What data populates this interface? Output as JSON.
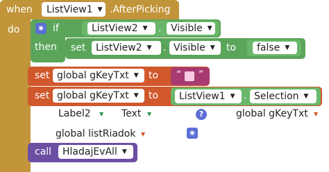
{
  "event": {
    "when": "when",
    "component": "ListView1",
    "event_name": ".AfterPicking",
    "do": "do"
  },
  "if_block": {
    "if": "if",
    "then": "then"
  },
  "cond": {
    "component": "ListView2",
    "dot": ".",
    "property": "Visible"
  },
  "set_visible": {
    "set": "set",
    "component": "ListView2",
    "dot": ".",
    "property": "Visible",
    "to": "to",
    "value": "false"
  },
  "set_global1": {
    "set": "set",
    "var": "global gKeyTxt",
    "to": "to",
    "value": ""
  },
  "set_global2": {
    "set": "set",
    "var": "global gKeyTxt",
    "to": "to",
    "component": "ListView1",
    "dot": ".",
    "property": "Selection"
  },
  "stray": {
    "label2": "Label2",
    "text": "Text",
    "global_gkeytxt": "global gKeyTxt",
    "global_listriadok": "global listRiadok",
    "help": "?"
  },
  "call_block": {
    "call": "call",
    "proc": "HladajEvAll"
  },
  "colors": {
    "event": "#c2953a",
    "logic": "#5ba55b",
    "variable": "#d0582c",
    "procedure": "#6c4fa3",
    "control_icon": "#5b6fd6"
  }
}
